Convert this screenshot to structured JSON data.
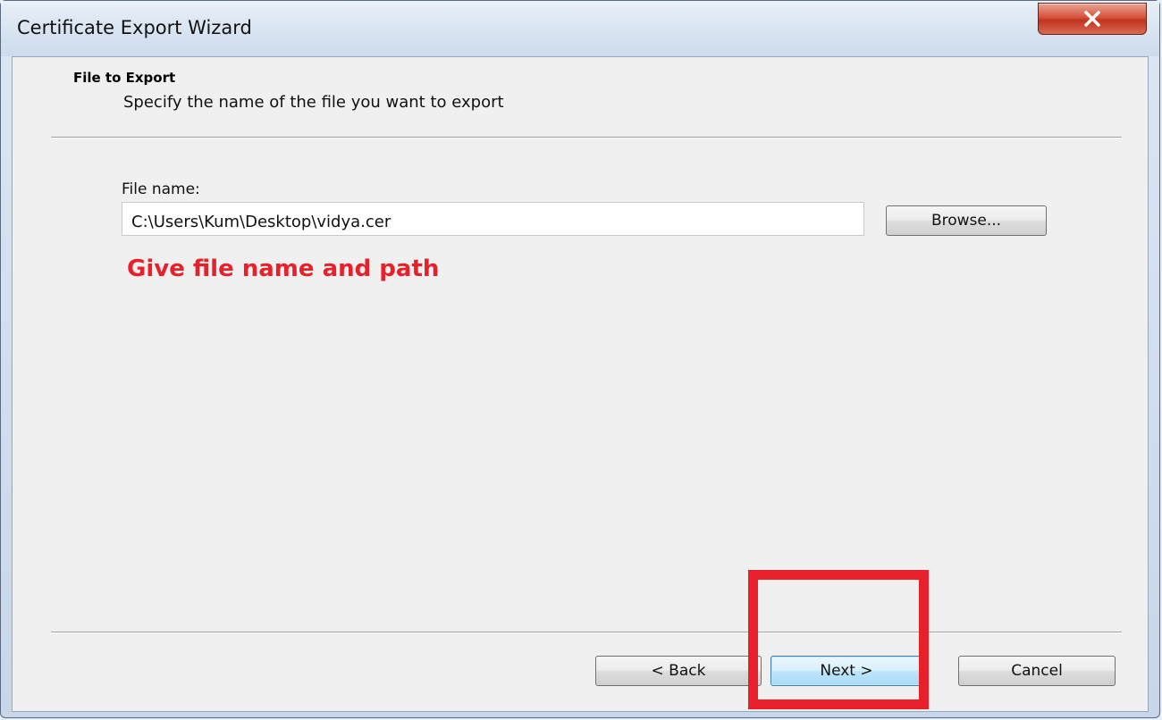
{
  "window": {
    "title": "Certificate Export Wizard",
    "close_icon": "close-icon"
  },
  "header": {
    "title": "File to Export",
    "subtitle": "Specify the name of the file you want to export"
  },
  "form": {
    "file_name_label": "File name:",
    "file_name_value": "C:\\Users\\Kum\\Desktop\\vidya.cer",
    "browse_label": "Browse..."
  },
  "annotation": {
    "instruction": "Give file name and path",
    "color": "#e8202a"
  },
  "footer": {
    "back_label": "< Back",
    "next_label": "Next >",
    "cancel_label": "Cancel"
  }
}
